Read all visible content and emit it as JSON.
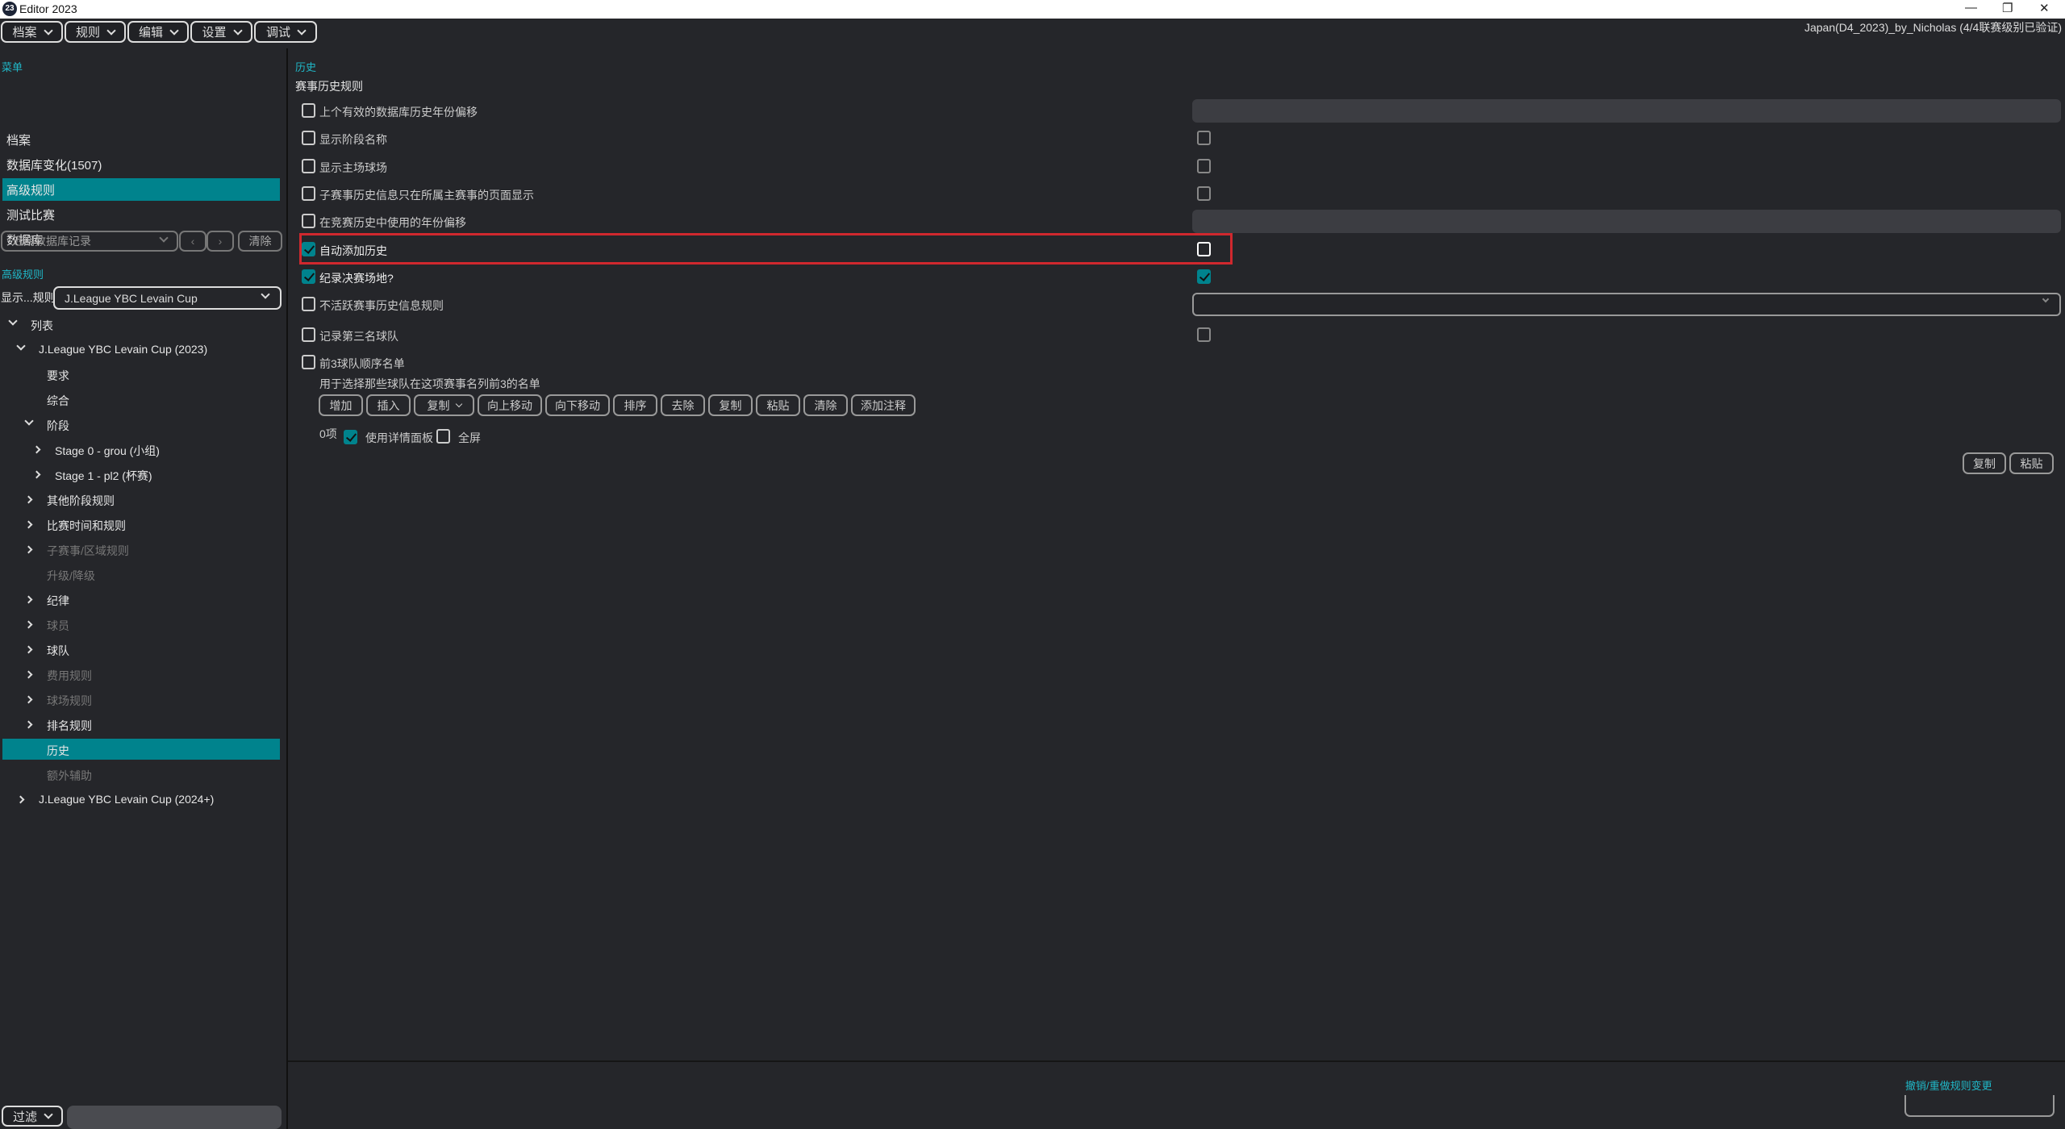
{
  "window": {
    "title": "Editor 2023",
    "logo": "23",
    "project": "Japan(D4_2023)_by_Nicholas (4/4联赛级别已验证)"
  },
  "menubar": [
    {
      "label": "档案"
    },
    {
      "label": "规则"
    },
    {
      "label": "编辑"
    },
    {
      "label": "设置"
    },
    {
      "label": "调试"
    }
  ],
  "sidebar": {
    "menu_header": "菜单",
    "items": [
      {
        "label": "档案"
      },
      {
        "label": "数据库变化(1507)"
      },
      {
        "label": "高级规则",
        "selected": true
      },
      {
        "label": "测试比赛"
      },
      {
        "label": "数据库"
      }
    ],
    "recent_placeholder": "近期数据库记录",
    "clear_label": "清除",
    "adv_header": "高级规则",
    "show_label": "显示...规则",
    "show_value": "J.League YBC Levain Cup",
    "tree": [
      {
        "label": "列表",
        "level": 0,
        "arrow": "down"
      },
      {
        "label": "J.League YBC Levain Cup (2023)",
        "level": 1,
        "arrow": "down"
      },
      {
        "label": "要求",
        "level": 3,
        "arrow": ""
      },
      {
        "label": "综合",
        "level": 3,
        "arrow": ""
      },
      {
        "label": "阶段",
        "level": 2,
        "arrow": "down"
      },
      {
        "label": "Stage 0 - grou (小组)",
        "level": 4,
        "arrow": "right"
      },
      {
        "label": "Stage 1 - pl2  (杯赛)",
        "level": 4,
        "arrow": "right"
      },
      {
        "label": "其他阶段规则",
        "level": 2,
        "arrow": "right"
      },
      {
        "label": "比赛时间和规则",
        "level": 2,
        "arrow": "right"
      },
      {
        "label": "子赛事/区域规则",
        "level": 2,
        "arrow": "right",
        "dim": true
      },
      {
        "label": "升级/降级",
        "level": 3,
        "arrow": "",
        "dim": true
      },
      {
        "label": "纪律",
        "level": 2,
        "arrow": "right"
      },
      {
        "label": "球员",
        "level": 2,
        "arrow": "right",
        "dim": true
      },
      {
        "label": "球队",
        "level": 2,
        "arrow": "right"
      },
      {
        "label": "费用规则",
        "level": 2,
        "arrow": "right",
        "dim": true
      },
      {
        "label": "球场规则",
        "level": 2,
        "arrow": "right",
        "dim": true
      },
      {
        "label": "排名规则",
        "level": 2,
        "arrow": "right"
      },
      {
        "label": "历史",
        "level": 3,
        "arrow": "",
        "selected": true
      },
      {
        "label": "额外辅助",
        "level": 3,
        "arrow": "",
        "dim": true
      },
      {
        "label": "J.League YBC Levain Cup (2024+)",
        "level": 1,
        "arrow": "right"
      }
    ],
    "filter_label": "过滤"
  },
  "main": {
    "breadcrumb": "历史",
    "section_title": "赛事历史规则",
    "rows": [
      {
        "label": "上个有效的数据库历史年份偏移",
        "checked": false,
        "control": "field"
      },
      {
        "label": "显示阶段名称",
        "checked": false,
        "control": "checkbox",
        "value": false
      },
      {
        "label": "显示主场球场",
        "checked": false,
        "control": "checkbox",
        "value": false
      },
      {
        "label": "子赛事历史信息只在所属主赛事的页面显示",
        "checked": false,
        "control": "checkbox",
        "value": false
      },
      {
        "label": "在竞赛历史中使用的年份偏移",
        "checked": false,
        "control": "field"
      },
      {
        "label": "自动添加历史",
        "checked": true,
        "control": "checkbox",
        "value": false,
        "highlighted": true
      },
      {
        "label": "纪录决赛场地?",
        "checked": true,
        "control": "checkbox",
        "value": true
      },
      {
        "label": "不活跃赛事历史信息规则",
        "checked": false,
        "control": "dropdown"
      },
      {
        "label": "记录第三名球队",
        "checked": false,
        "control": "checkbox",
        "value": false
      },
      {
        "label": "前3球队顺序名单",
        "checked": false,
        "control": "none"
      }
    ],
    "list_desc": "用于选择那些球队在这项赛事名列前3的名单",
    "list_buttons": [
      "增加",
      "插入",
      "复制",
      "向上移动",
      "向下移动",
      "排序",
      "去除",
      "复制",
      "粘贴",
      "清除",
      "添加注释"
    ],
    "count": "0项",
    "use_detail": "使用详情面板",
    "use_detail_checked": true,
    "fullscreen": "全屏",
    "fullscreen_checked": false,
    "copy_label": "复制",
    "paste_label": "粘贴",
    "undo_label": "撤销/重做规则变更"
  },
  "colors": {
    "accent": "#00838d",
    "link": "#20b8c8",
    "highlight": "#d0282e",
    "bg": "#25262a"
  }
}
